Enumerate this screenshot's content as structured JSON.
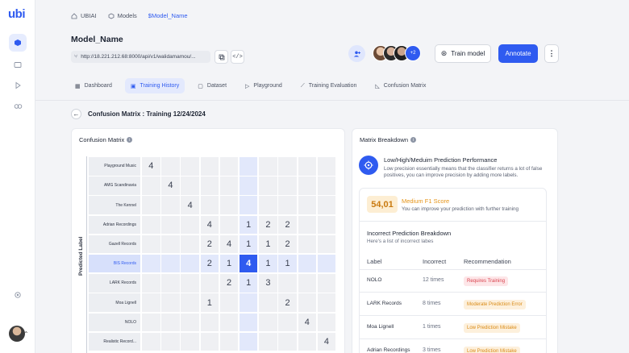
{
  "app": {
    "logo": "ubi"
  },
  "breadcrumbs": [
    {
      "label": "UBIAI"
    },
    {
      "label": "Models"
    },
    {
      "label": "$Model_Name"
    }
  ],
  "model": {
    "name": "Model_Name",
    "url": "http://18.221.212.68:8000/api/v1/walidamamou/..."
  },
  "collaborators": {
    "more": "+2"
  },
  "actions": {
    "train": "Train model",
    "annotate": "Annotate"
  },
  "tabs": [
    {
      "label": "Dashboard"
    },
    {
      "label": "Training History"
    },
    {
      "label": "Dataset"
    },
    {
      "label": "Playground"
    },
    {
      "label": "Training Evaluation"
    },
    {
      "label": "Confusion Matrix"
    }
  ],
  "page": {
    "heading": "Confusion Matrix : Training 12/24/2024"
  },
  "matrix": {
    "title": "Confusion Matrix",
    "y_axis_label": "Predicted Label",
    "labels": [
      "Playground Music",
      "AMG Scandinavia",
      "The Kennel",
      "Adrian Recordings",
      "Gazell Records",
      "BIS Records",
      "LARK Records",
      "Moa Lignell",
      "NOLO",
      "Realistic Record..."
    ],
    "rows": [
      [
        "4",
        "",
        "",
        "",
        "",
        "",
        "",
        "",
        "",
        ""
      ],
      [
        "",
        "4",
        "",
        "",
        "",
        "",
        "",
        "",
        "",
        ""
      ],
      [
        "",
        "",
        "4",
        "",
        "",
        "",
        "",
        "",
        "",
        ""
      ],
      [
        "",
        "",
        "",
        "4",
        "",
        "1",
        "2",
        "2",
        "",
        ""
      ],
      [
        "",
        "",
        "",
        "2",
        "4",
        "1",
        "1",
        "2",
        "",
        ""
      ],
      [
        "",
        "",
        "",
        "2",
        "1",
        "4",
        "1",
        "1",
        "",
        ""
      ],
      [
        "",
        "",
        "",
        "",
        "2",
        "1",
        "3",
        "",
        "",
        ""
      ],
      [
        "",
        "",
        "",
        "1",
        "",
        "",
        "",
        "2",
        "",
        ""
      ],
      [
        "",
        "",
        "",
        "",
        "",
        "",
        "",
        "",
        "4",
        ""
      ],
      [
        "",
        "",
        "",
        "",
        "",
        "",
        "",
        "",
        "",
        "4"
      ]
    ],
    "selected_row": 5,
    "selected_col": 5
  },
  "breakdown": {
    "title": "Matrix Breakdown",
    "perf_title": "Low/High/Meduim Prediction Performance",
    "perf_sub": "Low precision essentially means that the classifier returns a lot of false positives, you can improve precision by adding more labels.",
    "f1_value": "54,01",
    "f1_title": "Medium F1 Score",
    "f1_sub": "You can improve your prediction with further training",
    "incorrect_title": "Incorrect Prediction Breakdown",
    "incorrect_sub": "Here's a list of incorrect labes",
    "columns": [
      "Label",
      "Incorrect",
      "Recommendation"
    ],
    "rows": [
      {
        "label": "NOLO",
        "incorrect": "12 times",
        "recommendation": "Requires Training",
        "color": "#d9434e",
        "bg": "#fde6e8"
      },
      {
        "label": "LARK Records",
        "incorrect": "8 times",
        "recommendation": "Moderate Prediction Error",
        "color": "#d98a15",
        "bg": "#fdf0dc"
      },
      {
        "label": "Moa Lignell",
        "incorrect": "1 times",
        "recommendation": "Low Prediction Mistake",
        "color": "#d98a15",
        "bg": "#fdf0dc"
      },
      {
        "label": "Adrian Recordings",
        "incorrect": "3 times",
        "recommendation": "Low Prediction Mistake",
        "color": "#d98a15",
        "bg": "#fdf0dc"
      }
    ]
  },
  "colors": {
    "accent": "#2f5bf0",
    "warning": "#e59418",
    "danger": "#d9434e"
  }
}
